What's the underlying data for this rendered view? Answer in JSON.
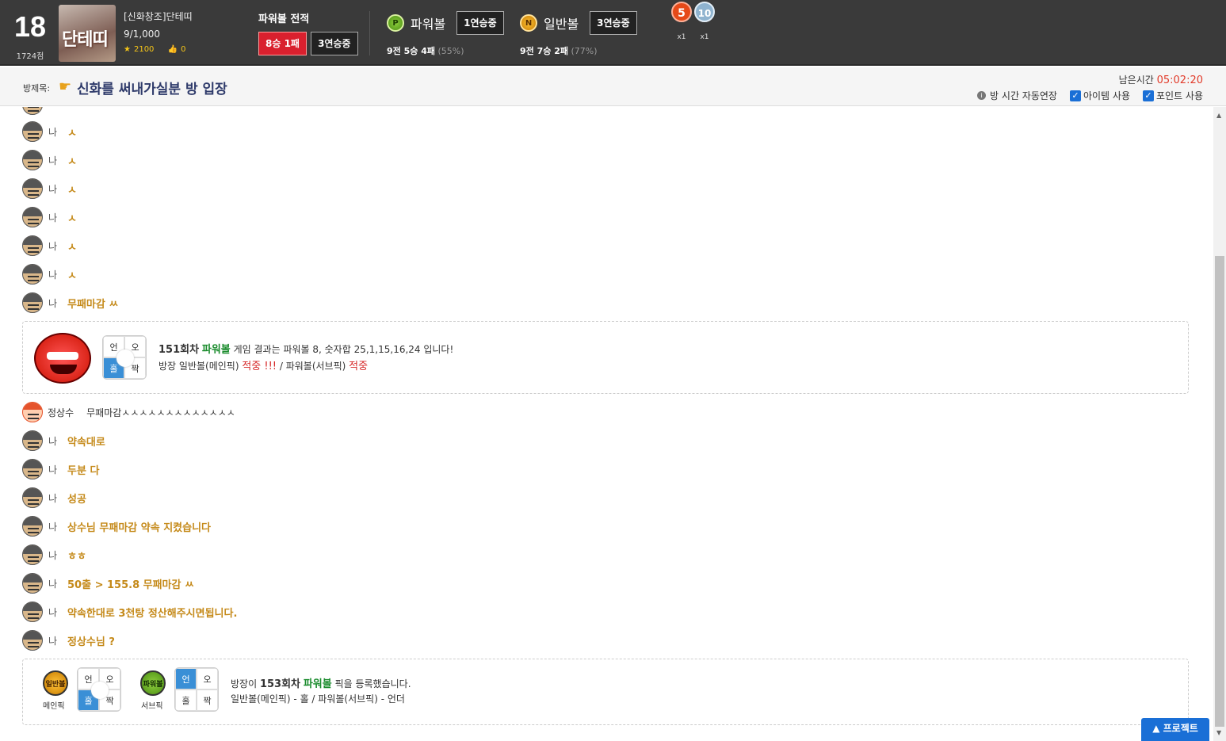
{
  "header": {
    "level": "18",
    "level_points": "1724점",
    "avatar_text": "단테띠",
    "username": "[신화창조]단테띠",
    "members": "9/1,000",
    "stars": "2100",
    "likes": "0",
    "record_title": "파워볼 전적",
    "record_wl": "8승 1패",
    "record_streak": "3연승중",
    "powerball": {
      "coin": "P",
      "label": "파워볼",
      "streak": "1연승중",
      "summary": "9전 5승 4패",
      "pct": "(55%)"
    },
    "normalball": {
      "coin": "N",
      "label": "일반볼",
      "streak": "3연승중",
      "summary": "9전 7승 2패",
      "pct": "(77%)"
    },
    "medals": [
      {
        "num": "5",
        "count": "x1"
      },
      {
        "num": "10",
        "count": "x1"
      }
    ]
  },
  "room": {
    "title_label": "방제목:",
    "title": "신화를 써내가실분 방 입장",
    "timer_label": "남은시간",
    "timer": "05:02:20",
    "opt_auto": "방 시간 자동연장",
    "opt_item": "아이템 사용",
    "opt_point": "포인트 사용"
  },
  "messages": [
    {
      "who": "나",
      "text": "ㅅ"
    },
    {
      "who": "나",
      "text": "ㅅ"
    },
    {
      "who": "나",
      "text": "ㅅ"
    },
    {
      "who": "나",
      "text": "ㅅ"
    },
    {
      "who": "나",
      "text": "ㅅ"
    },
    {
      "who": "나",
      "text": "ㅅ"
    },
    {
      "who": "나",
      "text": "무패마감 ㅆ"
    }
  ],
  "result1": {
    "grid": [
      "언",
      "오",
      "홀",
      "짝"
    ],
    "round": "151회차",
    "game": "파워볼",
    "line1": "게임 결과는 파워볼 8, 숫자합 25,1,15,16,24 입니다!",
    "line2_a": "방장 일반볼(메인픽)",
    "hit1": "적중 !!!",
    "line2_b": "/ 파워볼(서브픽)",
    "hit2": "적중"
  },
  "other_msg": {
    "who": "정상수",
    "text": "무패마감ㅅㅅㅅㅅㅅㅅㅅㅅㅅㅅㅅㅅㅅ"
  },
  "messages2": [
    {
      "who": "나",
      "text": "약속대로"
    },
    {
      "who": "나",
      "text": "두분 다"
    },
    {
      "who": "나",
      "text": "성공"
    },
    {
      "who": "나",
      "text": "상수님 무패마감 약속 지켰습니다"
    },
    {
      "who": "나",
      "text": "ㅎㅎ"
    },
    {
      "who": "나",
      "text": "50출 > 155.8 무패마감 ㅆ"
    },
    {
      "who": "나",
      "text": "약속한대로 3천탕 정산해주시면됩니다."
    },
    {
      "who": "나",
      "text": "정상수님 ?"
    }
  ],
  "result2": {
    "main_coin": "일반볼",
    "main_label": "메인픽",
    "sub_coin": "파워볼",
    "sub_label": "서브픽",
    "grid": [
      "언",
      "오",
      "홀",
      "짝"
    ],
    "line1_a": "방장이",
    "round": "153회차",
    "game": "파워볼",
    "line1_b": "픽을 등록했습니다.",
    "line2": "일반볼(메인픽) - 홀 / 파워볼(서브픽) - 언더"
  },
  "protect_label": "프로젝트",
  "colors": {
    "accent": "#c58a1a",
    "timer": "#e23b2a",
    "hit": "#d62828",
    "powerball": "#1b8c2e",
    "button": "#1a6fd6"
  }
}
